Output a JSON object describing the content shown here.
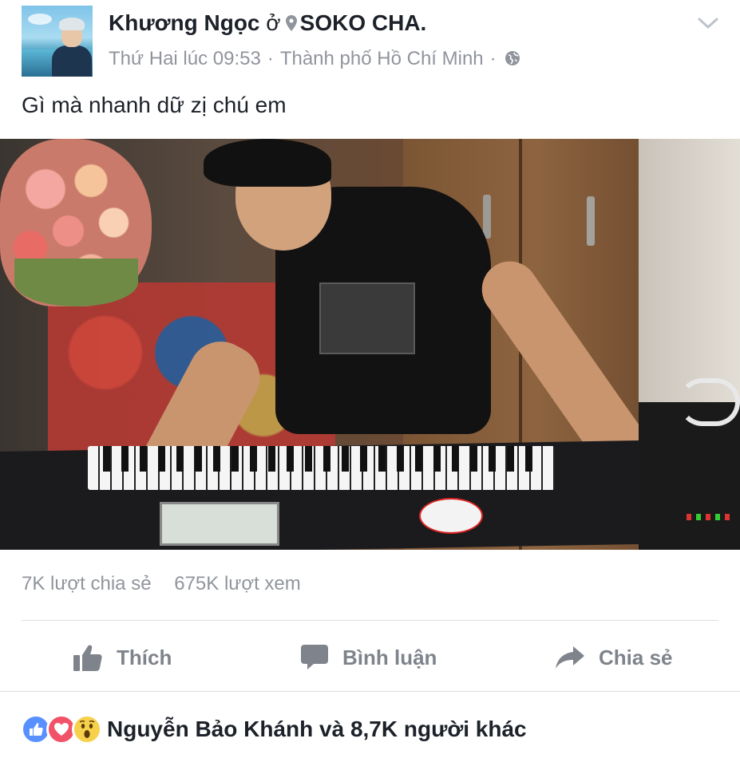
{
  "post": {
    "author": "Khương Ngọc",
    "at_word": "ở",
    "place": "SOKO CHA.",
    "time": "Thứ Hai lúc 09:53",
    "separator": "·",
    "city": "Thành phố Hồ Chí Minh",
    "text": "Gì mà nhanh dữ zị chú em"
  },
  "stats": {
    "shares": "7K lượt chia sẻ",
    "views": "675K lượt xem"
  },
  "actions": {
    "like": "Thích",
    "comment": "Bình luận",
    "share": "Chia sẻ"
  },
  "reactions": {
    "summary": "Nguyễn Bảo Khánh và 8,7K người khác",
    "icons": [
      "like-icon",
      "love-icon",
      "wow-icon"
    ]
  },
  "colors": {
    "text_primary": "#1d2129",
    "text_secondary": "#90949c",
    "action_gray": "#7f838b",
    "like_blue": "#5890ff",
    "love_red": "#f25268",
    "wow_yellow": "#f7d14c",
    "divider": "#dddfe2"
  }
}
